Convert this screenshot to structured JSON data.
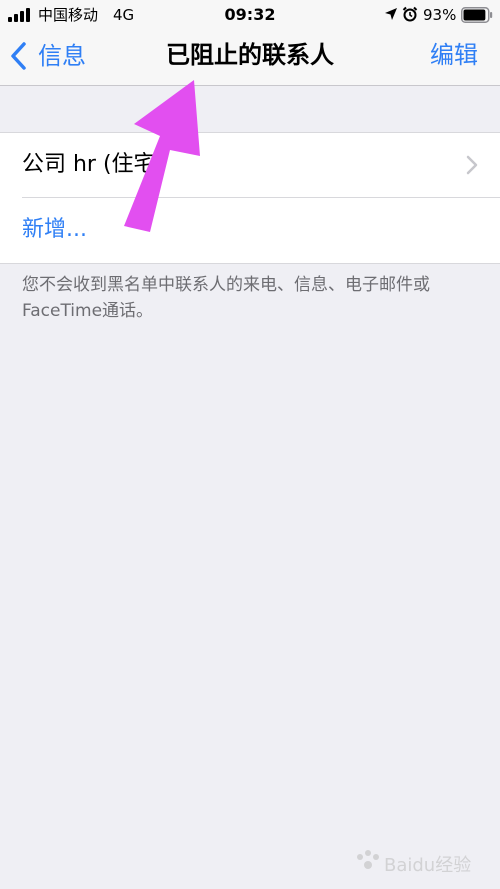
{
  "status_bar": {
    "carrier": "中国移动",
    "network": "4G",
    "time": "09:32",
    "battery_percent": "93%",
    "battery_level": 0.93
  },
  "nav": {
    "back_label": "信息",
    "title": "已阻止的联系人",
    "edit_label": "编辑"
  },
  "blocked_list": {
    "items": [
      {
        "label": "公司 hr (住宅)"
      }
    ],
    "add_label": "新增..."
  },
  "footnote": "您不会收到黑名单中联系人的来电、信息、电子邮件或FaceTime通话。",
  "colors": {
    "accent": "#2f7ff5",
    "annotation_arrow": "#e24ff0",
    "background": "#efeff4"
  },
  "watermark": {
    "text": "Baidu经验"
  }
}
